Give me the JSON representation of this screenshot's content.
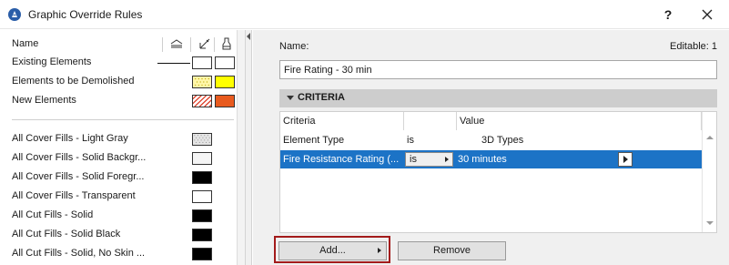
{
  "window": {
    "title": "Graphic Override Rules",
    "help_label": "?",
    "app_icon": "archicad-gear-icon",
    "close_icon": "close-icon"
  },
  "rules_list": {
    "header": {
      "name_label": "Name",
      "column_icons": [
        "fill-icon",
        "line-pen-icon",
        "background-pen-icon"
      ]
    },
    "items": [
      {
        "label": "Existing Elements",
        "swatches": [
          "line",
          "#ffffff",
          "#ffffff"
        ]
      },
      {
        "label": "Elements to be Demolished",
        "swatches": [
          "none",
          "hatch-yellow",
          "#ffff00"
        ]
      },
      {
        "label": "New Elements",
        "swatches": [
          "none",
          "hatch-red",
          "#e85a1e"
        ]
      },
      {
        "label": "All Cover Fills - Light Gray",
        "swatches": [
          "none",
          "dots-gray",
          "none"
        ]
      },
      {
        "label": "All Cover Fills - Solid Backgr...",
        "swatches": [
          "none",
          "#f5f5f5",
          "none"
        ]
      },
      {
        "label": "All Cover Fills - Solid Foregr...",
        "swatches": [
          "none",
          "#000000",
          "none"
        ]
      },
      {
        "label": "All Cover Fills - Transparent",
        "swatches": [
          "none",
          "#ffffff",
          "none"
        ]
      },
      {
        "label": "All Cut Fills - Solid",
        "swatches": [
          "none",
          "#000000",
          "none"
        ]
      },
      {
        "label": "All Cut Fills - Solid Black",
        "swatches": [
          "none",
          "#000000",
          "none"
        ]
      },
      {
        "label": "All Cut Fills - Solid, No Skin ...",
        "swatches": [
          "none",
          "#000000",
          "none"
        ]
      }
    ]
  },
  "details": {
    "name_label": "Name:",
    "editable_label": "Editable: 1",
    "name_value": "Fire Rating - 30 min",
    "criteria_section_label": "CRITERIA",
    "criteria_table": {
      "headers": [
        "Criteria",
        "",
        "Value"
      ],
      "rows": [
        {
          "criteria": "Element Type",
          "operator": "is",
          "value": "3D Types",
          "selected": false
        },
        {
          "criteria": "Fire Resistance Rating (...",
          "operator": "is",
          "value": "30 minutes",
          "selected": true
        }
      ]
    },
    "add_button_label": "Add...",
    "remove_button_label": "Remove"
  },
  "colors": {
    "selection_blue": "#1c73c6",
    "highlight_red": "#a31b1b",
    "section_header_gray": "#cdcdcd"
  }
}
